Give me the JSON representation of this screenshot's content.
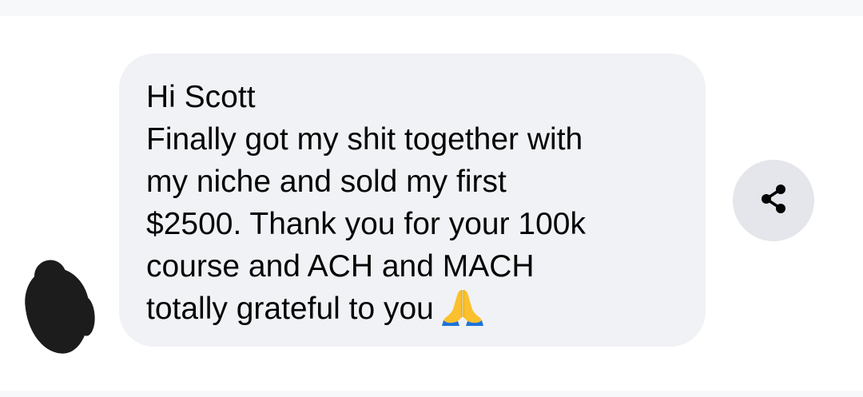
{
  "message": {
    "lines": [
      "Hi Scott",
      "Finally got my shit together with",
      "my niche and sold my first",
      "$2500. Thank you for your 100k",
      "course and ACH and MACH",
      "totally grateful to you"
    ],
    "emoji": "folded-hands-emoji"
  },
  "icons": {
    "share": "share-icon"
  },
  "colors": {
    "bubble_background": "#f0f2f5",
    "share_button_background": "#e4e6eb",
    "text": "#050505"
  }
}
